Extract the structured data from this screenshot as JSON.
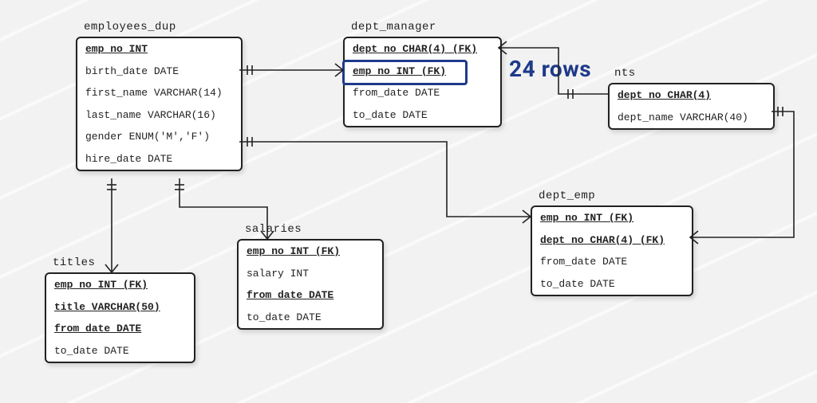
{
  "annotation": {
    "text": "24 rows"
  },
  "entities": {
    "employees_dup": {
      "title": "employees_dup",
      "rows": [
        {
          "text": "emp_no INT",
          "key": true
        },
        {
          "text": "birth_date DATE"
        },
        {
          "text": "first_name VARCHAR(14)"
        },
        {
          "text": "last_name VARCHAR(16)"
        },
        {
          "text": "gender ENUM('M','F')"
        },
        {
          "text": "hire_date DATE"
        }
      ]
    },
    "dept_manager": {
      "title": "dept_manager",
      "rows": [
        {
          "text": "dept_no CHAR(4)  (FK)",
          "key": true
        },
        {
          "text": "emp_no INT  (FK)",
          "key": true,
          "highlighted": true
        },
        {
          "text": "from_date DATE"
        },
        {
          "text": "to_date DATE"
        }
      ]
    },
    "departments": {
      "title": "nts",
      "rows": [
        {
          "text": "dept_no CHAR(4)",
          "key": true
        },
        {
          "text": "dept_name VARCHAR(40)"
        }
      ]
    },
    "dept_emp": {
      "title": "dept_emp",
      "rows": [
        {
          "text": "emp_no INT  (FK)",
          "key": true
        },
        {
          "text": "dept_no CHAR(4)  (FK)",
          "key": true
        },
        {
          "text": "from_date DATE"
        },
        {
          "text": "to_date DATE"
        }
      ]
    },
    "salaries": {
      "title": "salaries",
      "rows": [
        {
          "text": "emp_no INT  (FK)",
          "key": true
        },
        {
          "text": "salary INT"
        },
        {
          "text": "from_date DATE",
          "key": true
        },
        {
          "text": "to_date DATE"
        }
      ]
    },
    "titles": {
      "title": "titles",
      "rows": [
        {
          "text": "emp_no INT  (FK)",
          "key": true
        },
        {
          "text": "title VARCHAR(50)",
          "key": true
        },
        {
          "text": "from_date DATE",
          "key": true
        },
        {
          "text": "to_date DATE"
        }
      ]
    }
  }
}
